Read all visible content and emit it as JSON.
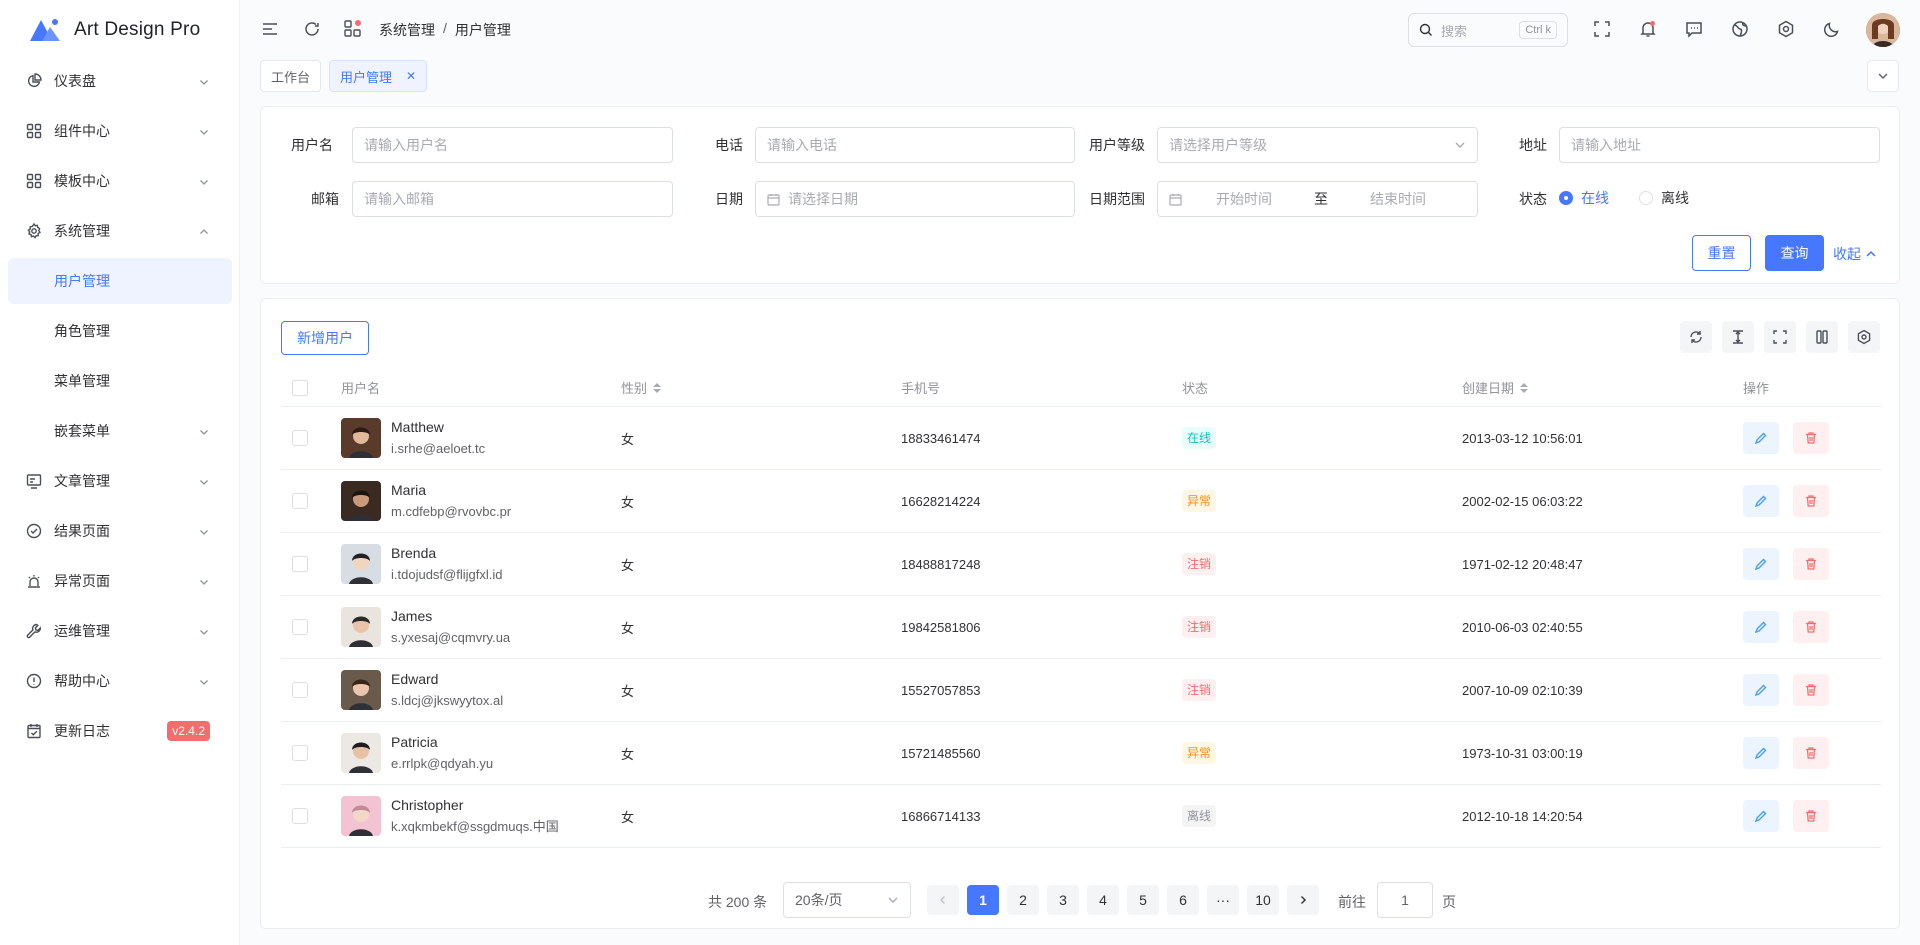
{
  "app": {
    "name": "Art Design Pro"
  },
  "sidebar": {
    "items": [
      {
        "label": "仪表盘",
        "icon": "pie-chart-icon",
        "chevron": "down"
      },
      {
        "label": "组件中心",
        "icon": "grid-icon",
        "chevron": "down"
      },
      {
        "label": "模板中心",
        "icon": "grid-icon",
        "chevron": "down"
      },
      {
        "label": "系统管理",
        "icon": "gear-icon",
        "chevron": "up"
      },
      {
        "label": "用户管理",
        "sub": true,
        "active": true
      },
      {
        "label": "角色管理",
        "sub": true
      },
      {
        "label": "菜单管理",
        "sub": true
      },
      {
        "label": "嵌套菜单",
        "sub": true,
        "chevron": "down"
      },
      {
        "label": "文章管理",
        "icon": "article-icon",
        "chevron": "down"
      },
      {
        "label": "结果页面",
        "icon": "check-circle-icon",
        "chevron": "down"
      },
      {
        "label": "异常页面",
        "icon": "alarm-icon",
        "chevron": "down"
      },
      {
        "label": "运维管理",
        "icon": "wrench-icon",
        "chevron": "down"
      },
      {
        "label": "帮助中心",
        "icon": "info-circle-icon",
        "chevron": "down"
      },
      {
        "label": "更新日志",
        "icon": "changelog-icon",
        "badge": "v2.4.2"
      }
    ]
  },
  "header": {
    "breadcrumb": [
      "系统管理",
      "用户管理"
    ],
    "search": {
      "placeholder": "搜索",
      "shortcut": "Ctrl k"
    }
  },
  "tabs": [
    {
      "label": "工作台",
      "active": false
    },
    {
      "label": "用户管理",
      "active": true,
      "close": "✕"
    }
  ],
  "filter": {
    "username": {
      "label": "用户名",
      "placeholder": "请输入用户名"
    },
    "phone": {
      "label": "电话",
      "placeholder": "请输入电话"
    },
    "level": {
      "label": "用户等级",
      "placeholder": "请选择用户等级"
    },
    "address": {
      "label": "地址",
      "placeholder": "请输入地址"
    },
    "email": {
      "label": "邮箱",
      "placeholder": "请输入邮箱"
    },
    "date": {
      "label": "日期",
      "placeholder": "请选择日期"
    },
    "range": {
      "label": "日期范围",
      "start": "开始时间",
      "sep": "至",
      "end": "结束时间"
    },
    "status": {
      "label": "状态",
      "options": [
        "在线",
        "离线"
      ],
      "selected": "在线"
    },
    "reset": "重置",
    "query": "查询",
    "collapse": "收起"
  },
  "table": {
    "add_button": "新增用户",
    "columns": {
      "user": "用户名",
      "gender": "性别",
      "phone": "手机号",
      "status": "状态",
      "created": "创建日期",
      "ops": "操作"
    },
    "rows": [
      {
        "name": "Matthew",
        "email": "i.srhe@aeloet.tc",
        "gender": "女",
        "phone": "18833461474",
        "status": "在线",
        "created": "2013-03-12 10:56:01"
      },
      {
        "name": "Maria",
        "email": "m.cdfebp@rvovbc.pr",
        "gender": "女",
        "phone": "16628214224",
        "status": "异常",
        "created": "2002-02-15 06:03:22"
      },
      {
        "name": "Brenda",
        "email": "i.tdojudsf@flijgfxl.id",
        "gender": "女",
        "phone": "18488817248",
        "status": "注销",
        "created": "1971-02-12 20:48:47"
      },
      {
        "name": "James",
        "email": "s.yxesaj@cqmvry.ua",
        "gender": "女",
        "phone": "19842581806",
        "status": "注销",
        "created": "2010-06-03 02:40:55"
      },
      {
        "name": "Edward",
        "email": "s.ldcj@jkswyytox.al",
        "gender": "女",
        "phone": "15527057853",
        "status": "注销",
        "created": "2007-10-09 02:10:39"
      },
      {
        "name": "Patricia",
        "email": "e.rrlpk@qdyah.yu",
        "gender": "女",
        "phone": "15721485560",
        "status": "异常",
        "created": "1973-10-31 03:00:19"
      },
      {
        "name": "Christopher",
        "email": "k.xqkmbekf@ssgdmuqs.中国",
        "gender": "女",
        "phone": "16866714133",
        "status": "离线",
        "created": "2012-10-18 14:20:54"
      }
    ]
  },
  "pagination": {
    "total": "共 200 条",
    "page_size": "20条/页",
    "pages": [
      "1",
      "2",
      "3",
      "4",
      "5",
      "6",
      "···",
      "10"
    ],
    "current": "1",
    "goto_label": "前往",
    "goto_value": "1",
    "unit": "页"
  },
  "colors": {
    "primary": "#4577ff",
    "online": "#13c2c2",
    "abnormal": "#fa8c16",
    "cancelled": "#f56c6c",
    "offline": "#909399"
  }
}
